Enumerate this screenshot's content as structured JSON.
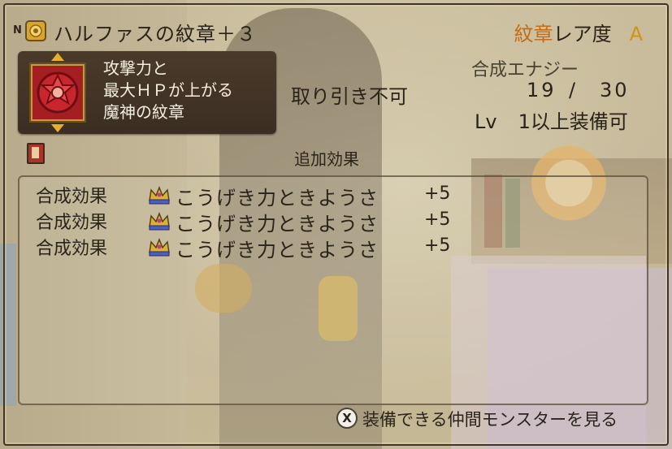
{
  "header": {
    "rank_letter": "N",
    "item_name": "ハルファスの紋章＋３",
    "rarity_category": "紋章",
    "rarity_label": "レア度",
    "rarity_grade": "A"
  },
  "description": {
    "lines": [
      "攻撃力と",
      "最大ＨＰが上がる",
      "魔神の紋章"
    ]
  },
  "info": {
    "tradable_status": "取り引き不可",
    "synthesis_label": "合成エナジー",
    "synthesis_current": "19",
    "synthesis_slash": "/",
    "synthesis_max": "30",
    "level_label": "Lv",
    "level_value": "1以上装備可"
  },
  "extra_effects": {
    "title": "追加効果",
    "rows": [
      {
        "label": "合成効果",
        "name": "こうげき力ときようさ",
        "value": "+5"
      },
      {
        "label": "合成効果",
        "name": "こうげき力ときようさ",
        "value": "+5"
      },
      {
        "label": "合成効果",
        "name": "こうげき力ときようさ",
        "value": "+5"
      }
    ]
  },
  "footer": {
    "button_glyph": "X",
    "action_text": "装備できる仲間モンスターを見る"
  },
  "colors": {
    "category_orange": "#c56d16",
    "grade_gold": "#d79113",
    "desc_panel": "#4a3a2a"
  },
  "icons": [
    "badge-icon",
    "emblem-icon",
    "book-icon",
    "crown-icon",
    "x-button-icon"
  ]
}
